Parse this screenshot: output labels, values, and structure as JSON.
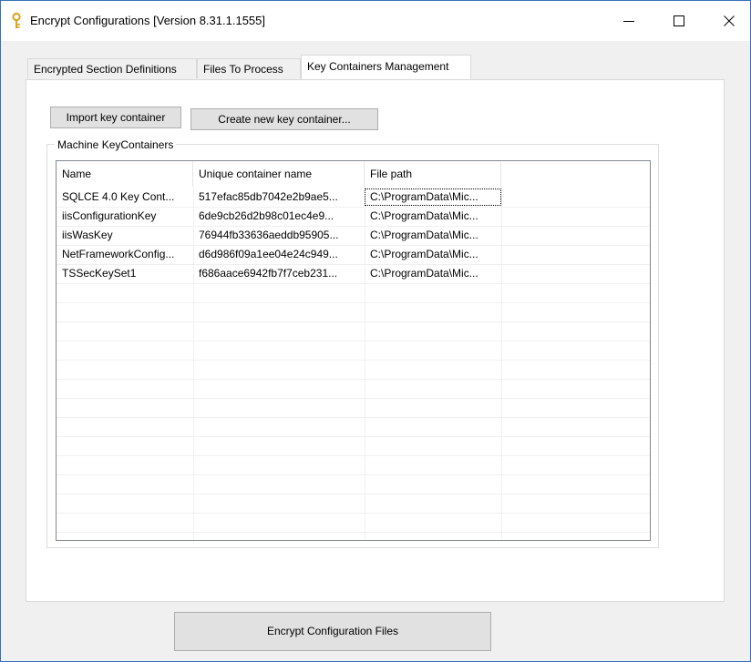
{
  "window": {
    "title": "Encrypt Configurations [Version 8.31.1.1555]",
    "icon": "key-icon",
    "controls": [
      "minimize-icon",
      "maximize-icon",
      "close-icon"
    ],
    "border_color": "#3a6fb6"
  },
  "tabs": [
    {
      "label": "Encrypted Section Definitions",
      "active": false
    },
    {
      "label": "Files To Process",
      "active": false
    },
    {
      "label": "Key Containers Management",
      "active": true
    }
  ],
  "key_containers": {
    "import_label": "Import key container",
    "create_label": "Create new key container...",
    "group_title": "Machine KeyContainers",
    "columns": [
      "Name",
      "Unique container name",
      "File path"
    ],
    "rows": [
      [
        "SQLCE 4.0 Key Cont...",
        "517efac85db7042e2b9ae5...",
        "C:\\ProgramData\\Mic..."
      ],
      [
        "iisConfigurationKey",
        "6de9cb26d2b98c01ec4e9...",
        "C:\\ProgramData\\Mic..."
      ],
      [
        "iisWasKey",
        "76944fb33636aeddb95905...",
        "C:\\ProgramData\\Mic..."
      ],
      [
        "NetFrameworkConfig...",
        "d6d986f09a1ee04e24c949...",
        "C:\\ProgramData\\Mic..."
      ],
      [
        "TSSecKeySet1",
        "f686aace6942fb7f7ceb231...",
        "C:\\ProgramData\\Mic..."
      ]
    ]
  },
  "footer": {
    "encrypt_label": "Encrypt Configuration Files"
  }
}
